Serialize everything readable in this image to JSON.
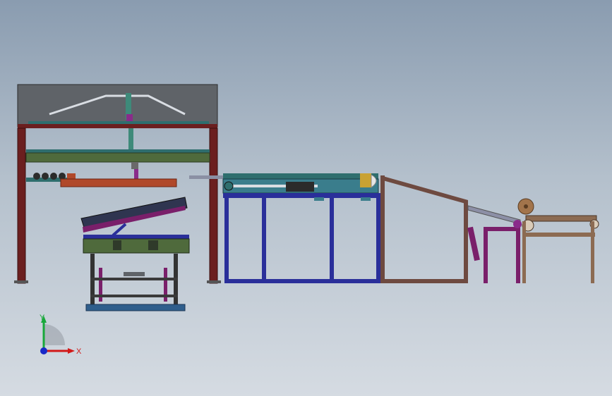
{
  "viewport": {
    "background_top": "#8a9cb0",
    "background_bottom": "#d5dbe2"
  },
  "machine": {
    "components": [
      "overhead-gantry",
      "tilting-table",
      "blue-conveyor-frame",
      "inclined-brown-frame",
      "pink-support-stand",
      "tan-roller-frame"
    ],
    "colors": {
      "dark_red_frame": "#6b1f1f",
      "gantry_cover": "#5f6368",
      "green_beam": "#4f6a3c",
      "orange_rail": "#b0482a",
      "blue_frame": "#2a2f9a",
      "teal_unit": "#3a7d8c",
      "brown_frame": "#6e4a40",
      "purple_support": "#7a1f6a",
      "tan_frame": "#8c6b52",
      "roller": "#a2744b"
    }
  },
  "triad": {
    "x_label": "X",
    "y_label": "Y",
    "x_color": "#d21818",
    "y_color": "#18a83a",
    "z_color": "#1828c8"
  }
}
